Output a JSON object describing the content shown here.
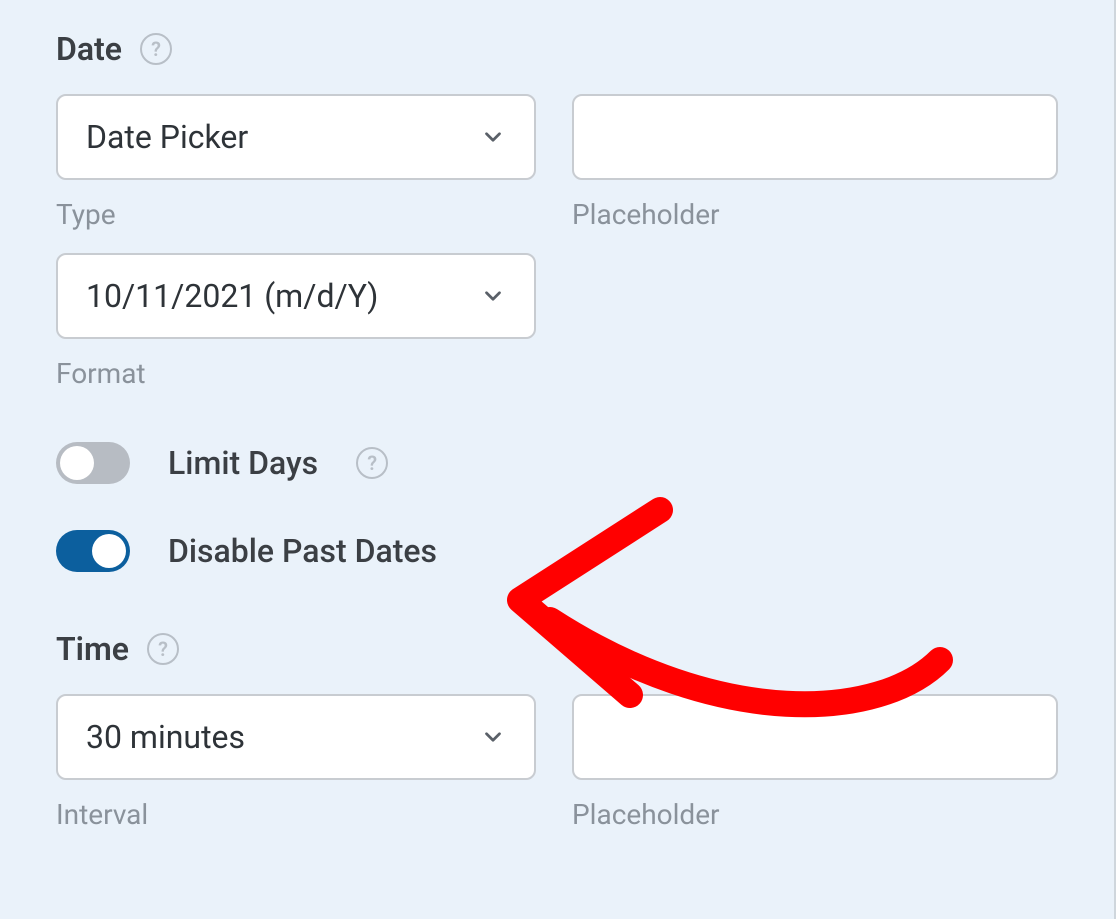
{
  "date_section": {
    "heading": "Date",
    "type_select": "Date Picker",
    "type_label": "Type",
    "placeholder_value": "",
    "placeholder_label": "Placeholder",
    "format_select": "10/11/2021 (m/d/Y)",
    "format_label": "Format",
    "limit_days_label": "Limit Days",
    "limit_days_on": false,
    "disable_past_label": "Disable Past Dates",
    "disable_past_on": true
  },
  "time_section": {
    "heading": "Time",
    "interval_select": "30 minutes",
    "interval_label": "Interval",
    "placeholder_value": "",
    "placeholder_label": "Placeholder"
  }
}
